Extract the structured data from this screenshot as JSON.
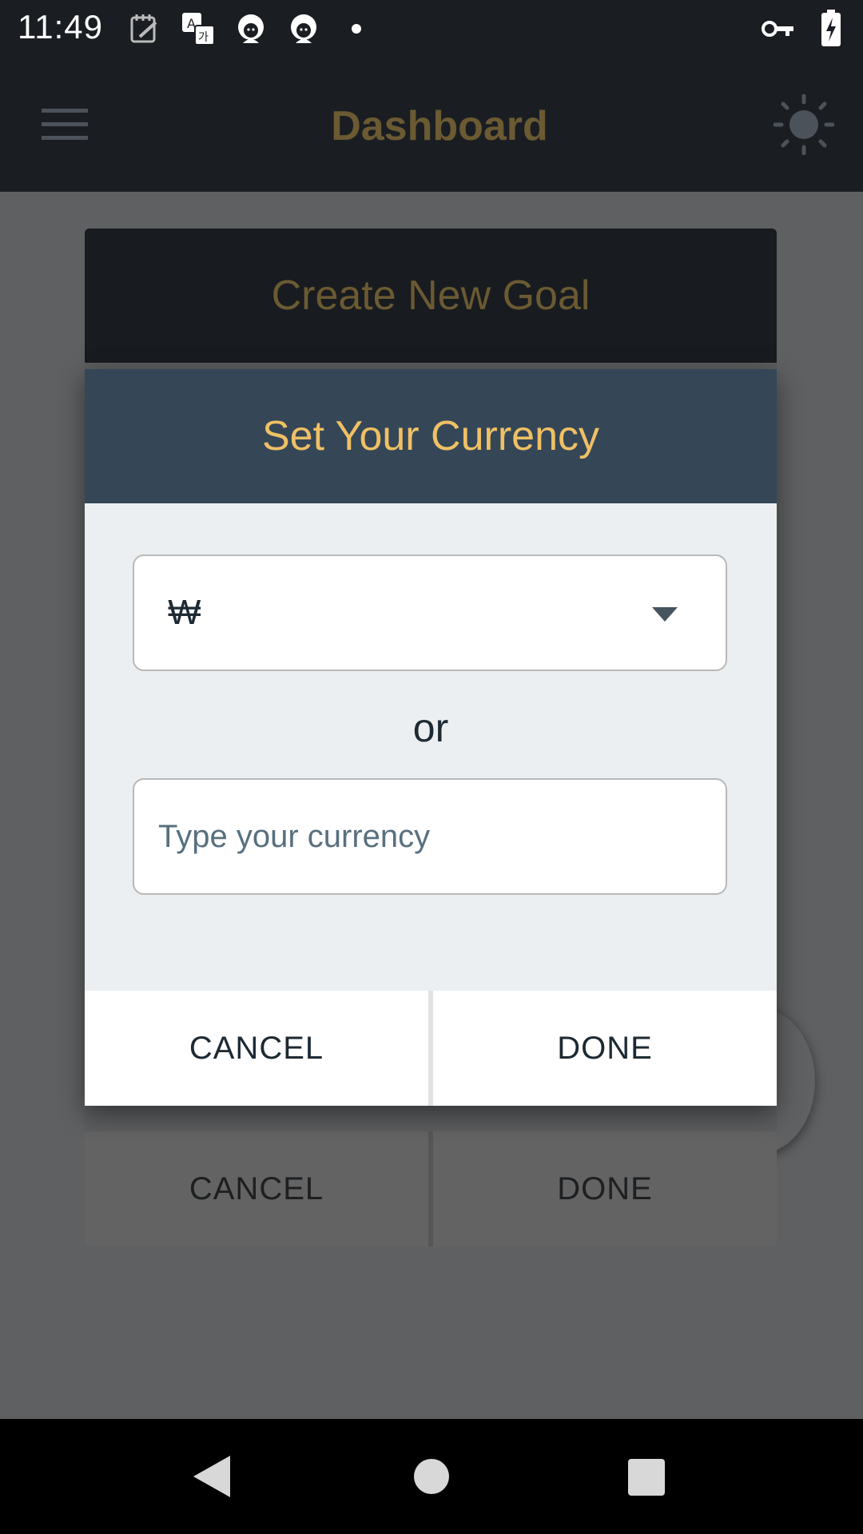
{
  "status_bar": {
    "time": "11:49",
    "left_icons": [
      "notes-icon",
      "translate-icon",
      "avatar-icon",
      "avatar-icon",
      "dot-icon"
    ],
    "right_icons": [
      "vpn-key-icon",
      "battery-charging-icon"
    ]
  },
  "app_bar": {
    "title": "Dashboard",
    "menu_icon": "hamburger-menu-icon",
    "theme_icon": "brightness-icon"
  },
  "goal_dialog": {
    "title": "Create New Goal",
    "cancel_label": "CANCEL",
    "done_label": "DONE"
  },
  "currency_dialog": {
    "title": "Set Your Currency",
    "selected_currency": "₩",
    "separator": "or",
    "input_placeholder": "Type your currency",
    "input_value": "",
    "cancel_label": "CANCEL",
    "done_label": "DONE"
  },
  "colors": {
    "app_bar_bg": "#1a1e23",
    "title_gold": "#6b5a32",
    "dialog_header_bg": "#354757",
    "dialog_title": "#f0c064"
  },
  "nav_bar": {
    "buttons": [
      "back-icon",
      "home-icon",
      "recents-icon"
    ]
  }
}
